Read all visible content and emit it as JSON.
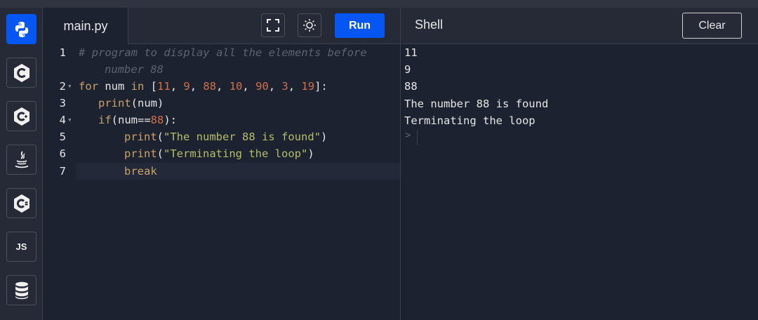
{
  "sidebar": {
    "items": [
      {
        "icon": "python-icon",
        "label": ""
      },
      {
        "icon": "c-icon",
        "label": ""
      },
      {
        "icon": "cpp-icon",
        "label": ""
      },
      {
        "icon": "java-icon",
        "label": ""
      },
      {
        "icon": "csharp-icon",
        "label": ""
      },
      {
        "icon": "js-icon",
        "label": "JS"
      },
      {
        "icon": "database-icon",
        "label": ""
      }
    ]
  },
  "editor": {
    "tab_label": "main.py",
    "run_label": "Run",
    "lines": [
      {
        "n": "1",
        "comment1": "# program to display all the elements before",
        "comment2": "number 88"
      },
      {
        "n": "2",
        "kw_for": "for",
        "var": " num ",
        "kw_in": "in",
        "open": " [",
        "v1": "11",
        "v2": "9",
        "v3": "88",
        "v4": "10",
        "v5": "90",
        "v6": "3",
        "v7": "19",
        "close": "]:"
      },
      {
        "n": "3",
        "call": "print",
        "args": "(num)"
      },
      {
        "n": "4",
        "call": "if",
        "pre": "(num==",
        "val": "88",
        "post": "):"
      },
      {
        "n": "5",
        "call": "print",
        "open": "(",
        "str": "\"The number 88 is found\"",
        "close": ")"
      },
      {
        "n": "6",
        "call": "print",
        "open": "(",
        "str": "\"Terminating the loop\"",
        "close": ")"
      },
      {
        "n": "7",
        "kw": "break"
      }
    ]
  },
  "shell": {
    "title": "Shell",
    "clear_label": "Clear",
    "output": [
      "11",
      "9",
      "88",
      "The number 88 is found",
      "Terminating the loop"
    ],
    "prompt": ">"
  },
  "colors": {
    "accent": "#0556f3",
    "background": "#1d2230",
    "keyword": "#c9a26a",
    "number": "#d0704a",
    "string": "#b5bd68",
    "comment": "#5c6370"
  }
}
